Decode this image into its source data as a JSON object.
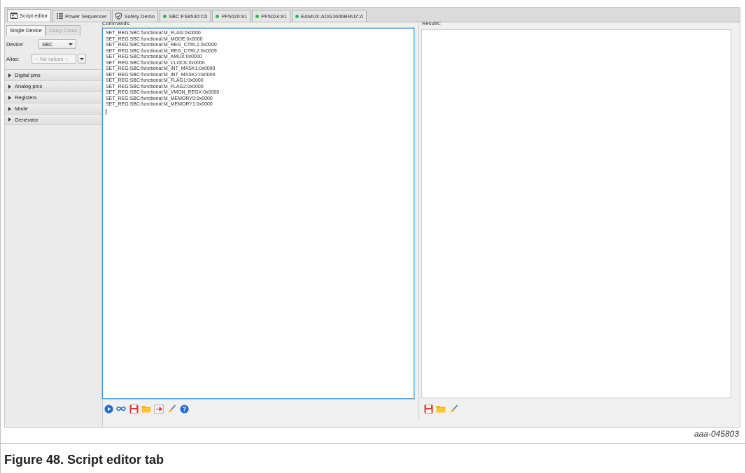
{
  "tabs": [
    {
      "label": "Script editor",
      "icon": "script-editor-icon",
      "active": true
    },
    {
      "label": "Power Sequencer",
      "icon": "list-icon",
      "active": false
    },
    {
      "label": "Safety Demo",
      "icon": "shield-check-icon",
      "active": false
    },
    {
      "label": "SBC:FS8530:C0",
      "icon": "status-dot",
      "active": false
    },
    {
      "label": "PF5020:81",
      "icon": "status-dot",
      "active": false
    },
    {
      "label": "PF5024:81",
      "icon": "status-dot",
      "active": false
    },
    {
      "label": "EAMUX:ADG1606BRUZ:A",
      "icon": "status-dot",
      "active": false
    }
  ],
  "status_color": "#2db84c",
  "left": {
    "subtabs": [
      "Single Device",
      "Daisy Chain"
    ],
    "device_label": "Device:",
    "device_value": "SBC",
    "alias_label": "Alias:",
    "alias_value": "-- No values --",
    "sections": [
      "Digital pins",
      "Analog pins",
      "Registers",
      "Mode",
      "Generator"
    ]
  },
  "commands": {
    "label": "Commands:",
    "lines": [
      "SET_REG:SBC:functional:M_FLAG:0x0000",
      "SET_REG:SBC:functional:M_MODE:0x0000",
      "SET_REG:SBC:functional:M_REG_CTRL1:0x0000",
      "SET_REG:SBC:functional:M_REG_CTRL2:0x0009",
      "SET_REG:SBC:functional:M_AMUX:0x0000",
      "SET_REG:SBC:functional:M_CLOCK:0x0000",
      "SET_REG:SBC:functional:M_INT_MASK1:0x0000",
      "SET_REG:SBC:functional:M_INT_MASK2:0x0000",
      "SET_REG:SBC:functional:M_FLAG1:0x0000",
      "SET_REG:SBC:functional:M_FLAG2:0x0000",
      "SET_REG:SBC:functional:M_VMON_REGX:0x0000",
      "SET_REG:SBC:functional:M_MEMORY0:0x0000",
      "SET_REG:SBC:functional:M_MEMORY1:0x0000"
    ],
    "toolbar": [
      "run-icon",
      "loop-icon",
      "save-icon",
      "open-folder-icon",
      "export-icon",
      "clear-icon",
      "help-icon"
    ]
  },
  "results": {
    "label": "Results:",
    "toolbar": [
      "save-icon",
      "open-folder-icon",
      "clear-icon"
    ]
  },
  "figure_ref": "aaa-045803",
  "caption": "Figure 48.  Script editor tab"
}
